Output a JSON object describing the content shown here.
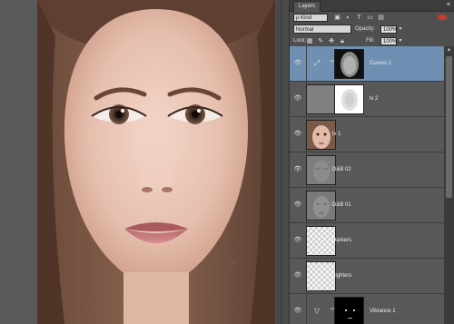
{
  "panel": {
    "tab_label": "Layers",
    "menu_icon": "panel-menu-icon",
    "filter": {
      "kind_label": "ρ Kind",
      "icons": [
        "image-filter-icon",
        "adjustment-filter-icon",
        "type-filter-icon",
        "shape-filter-icon",
        "smart-object-filter-icon"
      ],
      "toggle_color": "#c93a2e"
    },
    "blend_mode": "Normal",
    "opacity_label": "Opacity:",
    "opacity_value": "100%",
    "lock_label": "Lock:",
    "lock_icons": [
      "lock-transparent-icon",
      "lock-image-icon",
      "lock-position-icon",
      "lock-all-icon"
    ],
    "fill_label": "Fill:",
    "fill_value": "100%"
  },
  "layers": [
    {
      "name": "Curves 1",
      "type": "curves-adjustment",
      "selected": true,
      "visible": true
    },
    {
      "name": "lv 2",
      "type": "levels-adjustment",
      "selected": false,
      "visible": true
    },
    {
      "name": "lv 1",
      "type": "image",
      "selected": false,
      "visible": true
    },
    {
      "name": "D&B 02",
      "type": "image",
      "selected": false,
      "visible": true
    },
    {
      "name": "D&B 01",
      "type": "image",
      "selected": false,
      "visible": true
    },
    {
      "name": "Darkers",
      "type": "empty",
      "selected": false,
      "visible": true
    },
    {
      "name": "Lighters",
      "type": "empty",
      "selected": false,
      "visible": true
    },
    {
      "name": "Vibrance 1",
      "type": "vibrance-adjustment",
      "selected": false,
      "visible": true
    }
  ],
  "colors": {
    "selection": "#6f8fb3",
    "panel_bg": "#4f4f4f",
    "canvas_bg": "#5b5b5b"
  }
}
